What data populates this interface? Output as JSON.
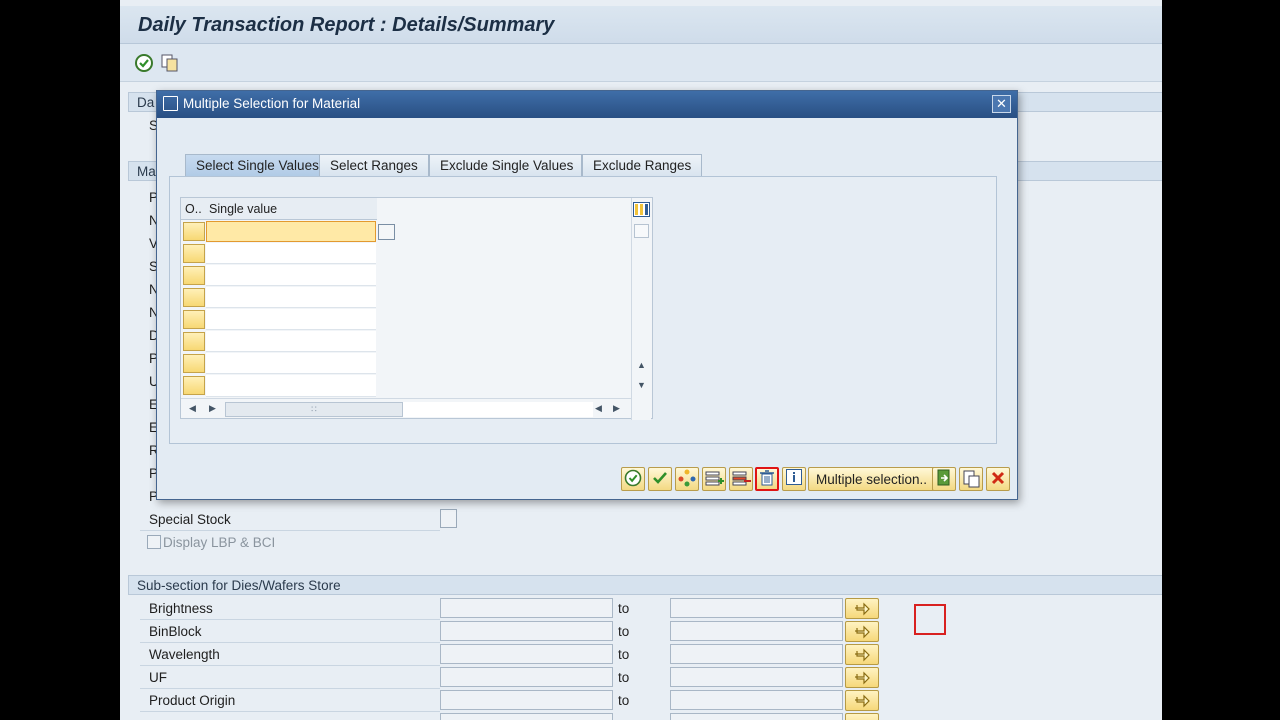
{
  "window": {
    "title": "Daily Transaction Report : Details/Summary"
  },
  "sections": {
    "top_partial": "Da",
    "top_row_partial": "S",
    "main_partial": "Ma",
    "main_labels_partial": [
      "P",
      "N",
      "V",
      "S",
      "N",
      "N",
      "D",
      "P",
      "U",
      "E",
      "E",
      "R",
      "P",
      "P"
    ],
    "special_stock": "Special Stock",
    "display_lbp": "Display LBP & BCI",
    "dies": {
      "header": "Sub-section for Dies/Wafers Store",
      "to_label": "to",
      "rows": [
        "Brightness",
        "BinBlock",
        "Wavelength",
        "UF",
        "Product Origin"
      ]
    }
  },
  "dialog": {
    "title": "Multiple Selection for Material",
    "close_label": "✕",
    "tabs": [
      {
        "label": "Select Single Values",
        "active": true
      },
      {
        "label": "Select Ranges",
        "active": false
      },
      {
        "label": "Exclude Single Values",
        "active": false
      },
      {
        "label": "Exclude Ranges",
        "active": false
      }
    ],
    "grid": {
      "col_option": "O..",
      "col_value": "Single value",
      "row_count": 8
    },
    "toolbar": {
      "multiple_selection": "Multiple selection.."
    }
  },
  "colors": {
    "accent": "#2a568d",
    "highlight": "#e01414",
    "button": "#f3d983"
  }
}
